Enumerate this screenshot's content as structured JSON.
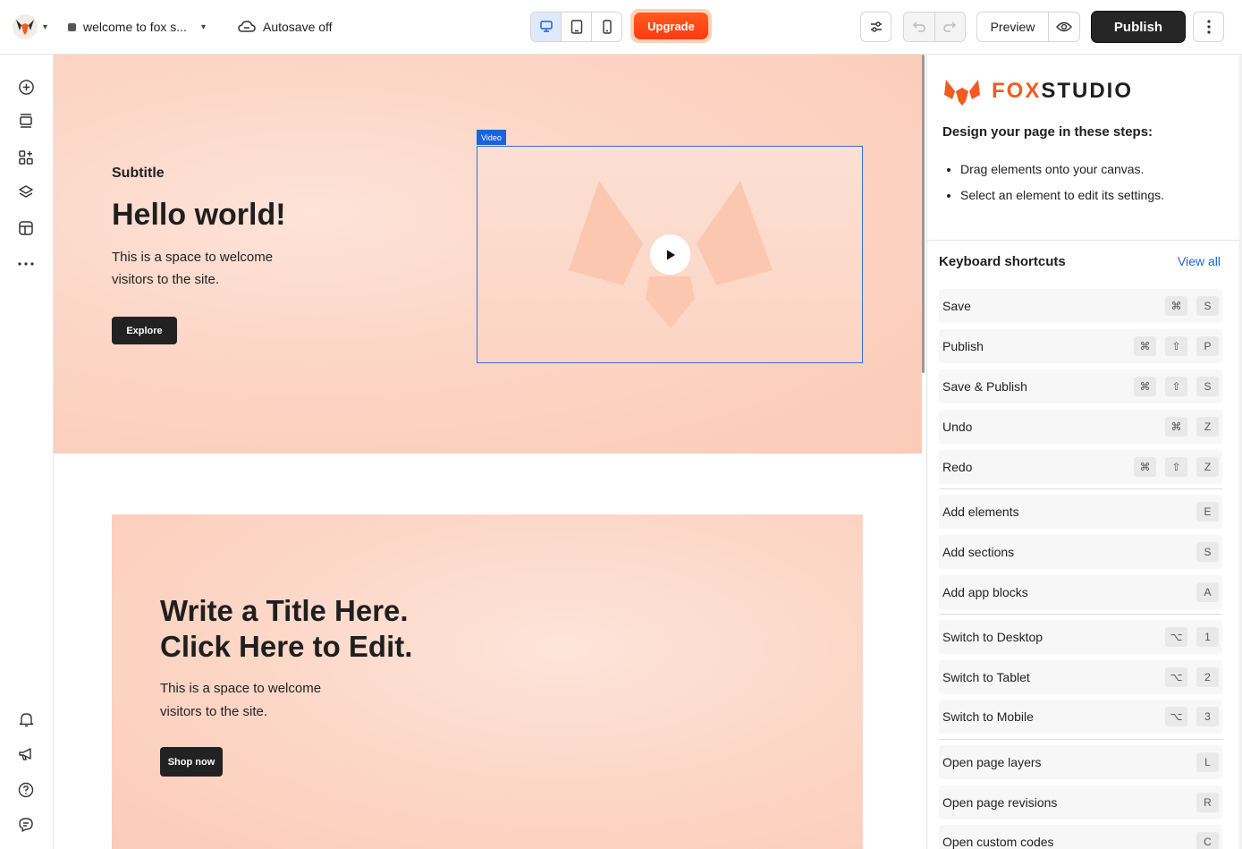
{
  "topbar": {
    "site_name": "welcome to fox s...",
    "autosave": "Autosave off",
    "upgrade": "Upgrade",
    "preview": "Preview",
    "publish": "Publish"
  },
  "canvas": {
    "hero": {
      "subtitle": "Subtitle",
      "title": "Hello world!",
      "description": "This is a space to welcome visitors to the site.",
      "button": "Explore",
      "video_label": "Video"
    },
    "section2": {
      "title_line1": "Write a Title Here.",
      "title_line2": "Click Here to Edit.",
      "description": "This is a space to welcome visitors to the site.",
      "button": "Shop now"
    }
  },
  "panel": {
    "brand_a": "FOX",
    "brand_b": "STUDIO",
    "steps_title": "Design your page in these steps:",
    "steps": [
      "Drag elements onto your canvas.",
      "Select an element to edit its settings."
    ],
    "shortcuts_title": "Keyboard shortcuts",
    "view_all": "View all",
    "shortcuts": [
      {
        "label": "Save",
        "keys": [
          "⌘",
          "S"
        ]
      },
      {
        "label": "Publish",
        "keys": [
          "⌘",
          "⇧",
          "P"
        ]
      },
      {
        "label": "Save & Publish",
        "keys": [
          "⌘",
          "⇧",
          "S"
        ]
      },
      {
        "label": "Undo",
        "keys": [
          "⌘",
          "Z"
        ]
      },
      {
        "label": "Redo",
        "keys": [
          "⌘",
          "⇧",
          "Z"
        ]
      },
      {
        "label": "Add elements",
        "keys": [
          "E"
        ]
      },
      {
        "label": "Add sections",
        "keys": [
          "S"
        ]
      },
      {
        "label": "Add app blocks",
        "keys": [
          "A"
        ]
      },
      {
        "label": "Switch to Desktop",
        "keys": [
          "⌥",
          "1"
        ]
      },
      {
        "label": "Switch to Tablet",
        "keys": [
          "⌥",
          "2"
        ]
      },
      {
        "label": "Switch to Mobile",
        "keys": [
          "⌥",
          "3"
        ]
      },
      {
        "label": "Open page layers",
        "keys": [
          "L"
        ]
      },
      {
        "label": "Open page revisions",
        "keys": [
          "R"
        ]
      },
      {
        "label": "Open custom codes",
        "keys": [
          "C"
        ]
      }
    ]
  },
  "colors": {
    "accent": "#1b63d8",
    "brand": "#f25a1f",
    "upgrade": "#ff4a17",
    "publish_bg": "#262626"
  }
}
